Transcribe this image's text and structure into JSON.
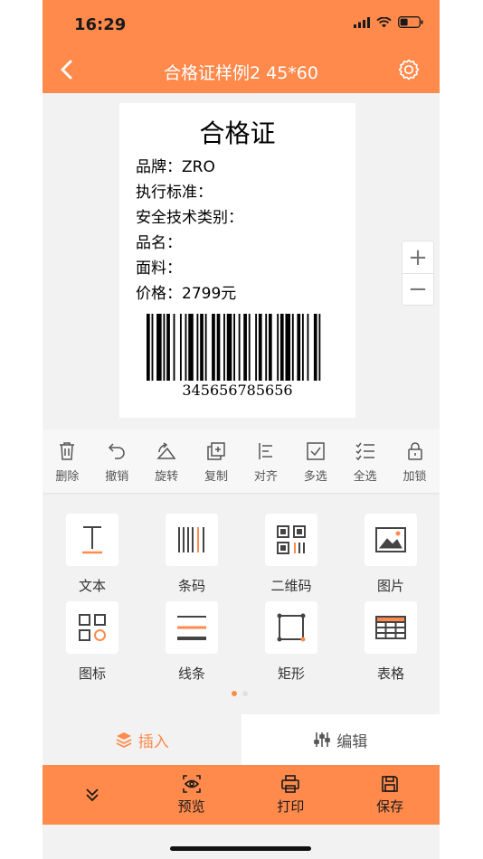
{
  "status": {
    "time": "16:29"
  },
  "nav": {
    "title": "合格证样例2  45*60"
  },
  "label": {
    "title": "合格证",
    "fields": [
      "品牌：ZRO",
      "执行标准：",
      "安全技术类别：",
      "品名：",
      "面料：",
      "价格：2799元"
    ],
    "barcode_number": "345656785656"
  },
  "zoom": {
    "in": "+",
    "out": "−"
  },
  "toolbar": [
    {
      "label": "删除",
      "icon": "trash-icon"
    },
    {
      "label": "撤销",
      "icon": "undo-icon"
    },
    {
      "label": "旋转",
      "icon": "rotate-icon"
    },
    {
      "label": "复制",
      "icon": "copy-icon"
    },
    {
      "label": "对齐",
      "icon": "align-icon"
    },
    {
      "label": "多选",
      "icon": "checkbox-icon"
    },
    {
      "label": "全选",
      "icon": "checklist-icon"
    },
    {
      "label": "加锁",
      "icon": "lock-icon"
    }
  ],
  "insert_items": [
    {
      "label": "文本",
      "icon": "text-icon"
    },
    {
      "label": "条码",
      "icon": "barcode-icon"
    },
    {
      "label": "二维码",
      "icon": "qrcode-icon"
    },
    {
      "label": "图片",
      "icon": "image-icon"
    },
    {
      "label": "图标",
      "icon": "shapes-icon"
    },
    {
      "label": "线条",
      "icon": "lines-icon"
    },
    {
      "label": "矩形",
      "icon": "rectangle-icon"
    },
    {
      "label": "表格",
      "icon": "table-icon"
    }
  ],
  "tabs": {
    "insert": "插入",
    "edit": "编辑"
  },
  "bottom": {
    "preview": "预览",
    "print": "打印",
    "save": "保存"
  },
  "colors": {
    "accent": "#ff8a4c",
    "text": "#333333"
  }
}
